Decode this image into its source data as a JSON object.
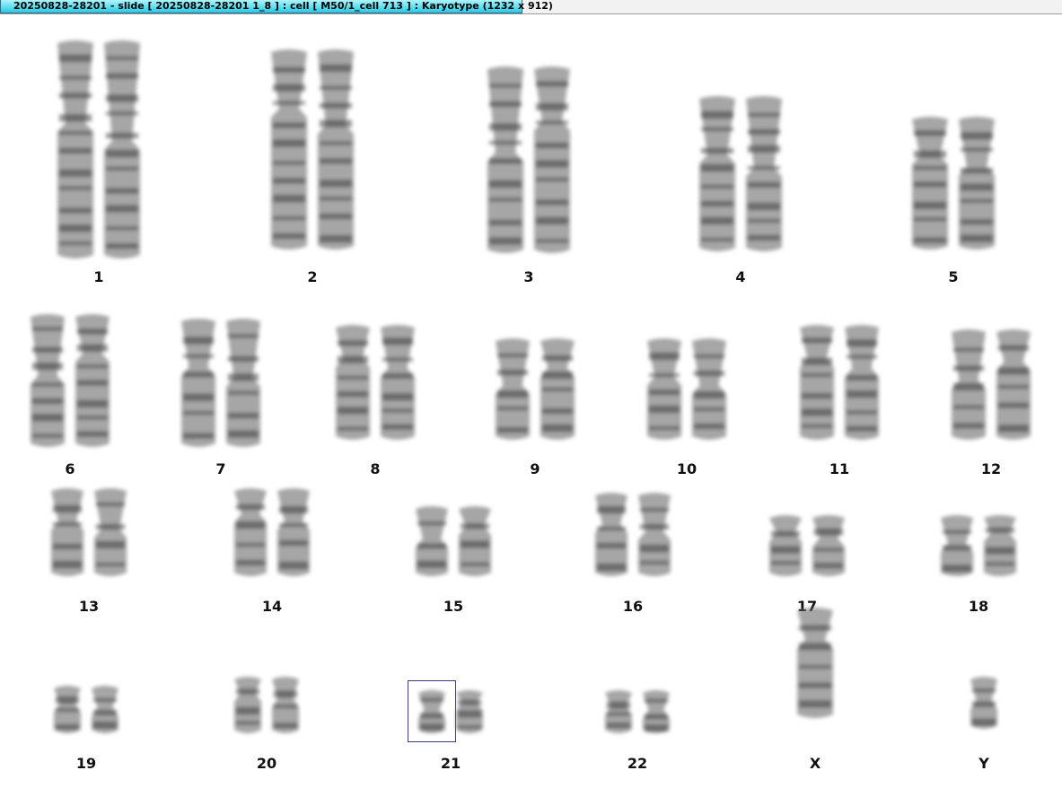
{
  "window": {
    "title": "20250828-28201 - slide [ 20250828-28201   1_8 ] : cell [ M50/1_cell 713 ] : Karyotype  (1232 x 912)"
  },
  "karyotype": {
    "pairs": [
      {
        "label": "1",
        "count": 2
      },
      {
        "label": "2",
        "count": 2
      },
      {
        "label": "3",
        "count": 2
      },
      {
        "label": "4",
        "count": 2
      },
      {
        "label": "5",
        "count": 2
      },
      {
        "label": "6",
        "count": 2
      },
      {
        "label": "7",
        "count": 2
      },
      {
        "label": "8",
        "count": 2
      },
      {
        "label": "9",
        "count": 2
      },
      {
        "label": "10",
        "count": 2
      },
      {
        "label": "11",
        "count": 2
      },
      {
        "label": "12",
        "count": 2
      },
      {
        "label": "13",
        "count": 2
      },
      {
        "label": "14",
        "count": 2
      },
      {
        "label": "15",
        "count": 2
      },
      {
        "label": "16",
        "count": 2
      },
      {
        "label": "17",
        "count": 2
      },
      {
        "label": "18",
        "count": 2
      },
      {
        "label": "19",
        "count": 2
      },
      {
        "label": "20",
        "count": 2
      },
      {
        "label": "21",
        "count": 2,
        "selected_index": 0
      },
      {
        "label": "22",
        "count": 2
      },
      {
        "label": "X",
        "count": 1
      },
      {
        "label": "Y",
        "count": 1
      }
    ],
    "colors": {
      "chromatin": "#6d6d6d",
      "band": "#3c3c3c",
      "selection": "#3a3a8a"
    }
  }
}
